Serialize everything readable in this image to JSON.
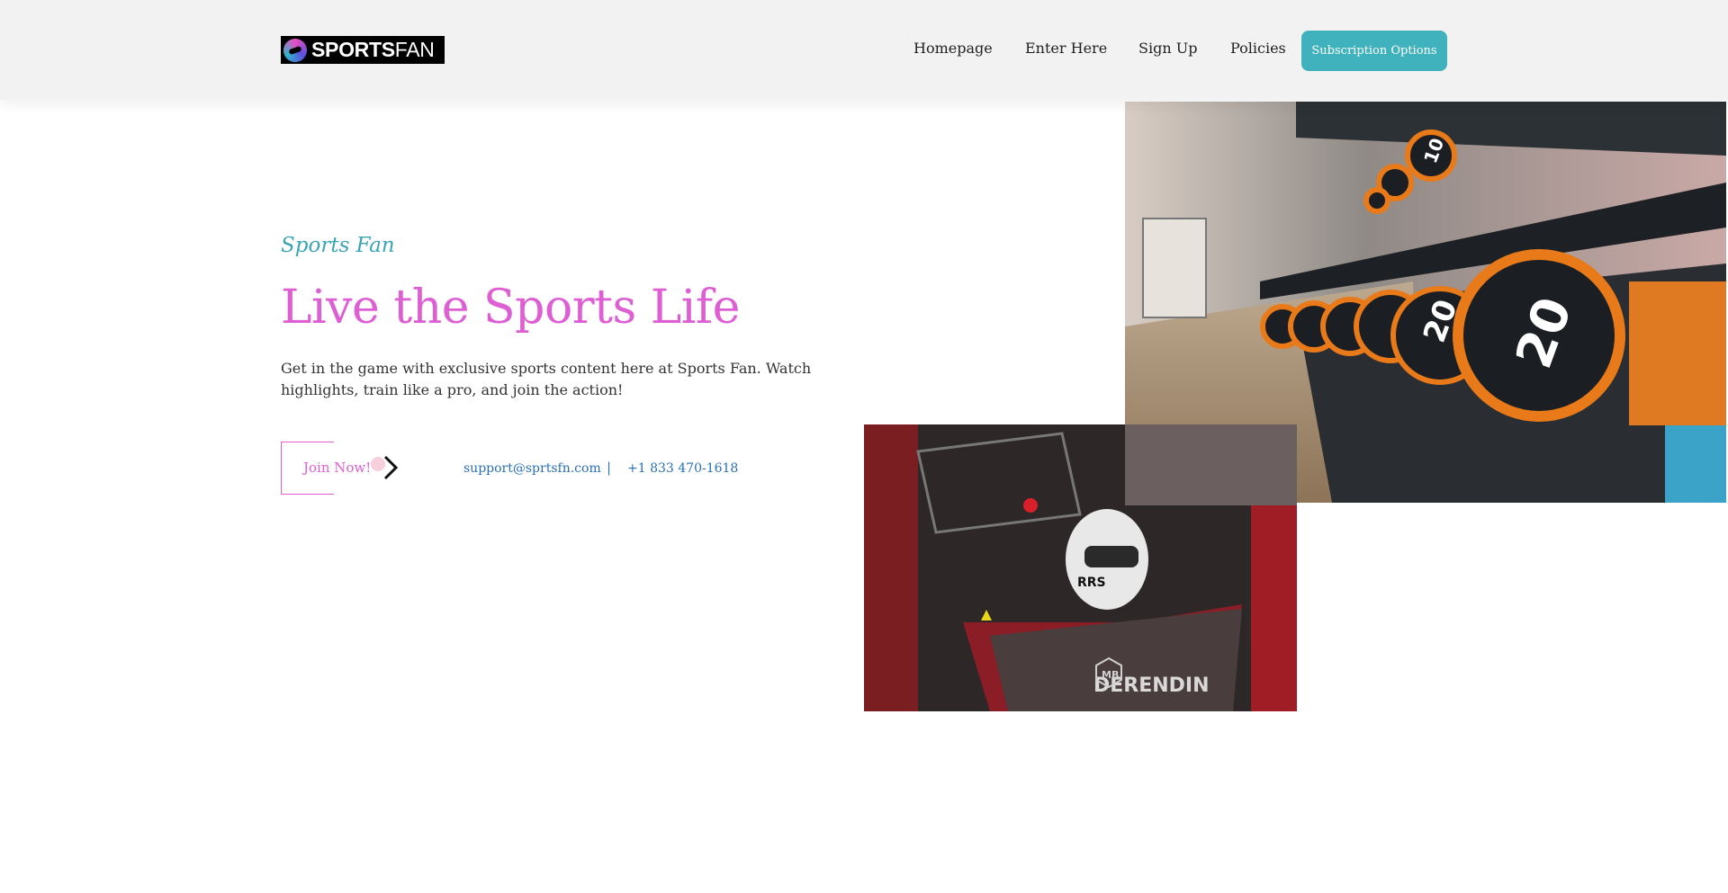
{
  "header": {
    "logo": {
      "bold_text": "SPORTS",
      "light_text": "FAN",
      "icon": "sportsfan-logo-icon"
    },
    "nav": [
      {
        "label": "Homepage"
      },
      {
        "label": "Enter Here"
      },
      {
        "label": "Sign Up"
      },
      {
        "label": "Policies"
      }
    ],
    "cta_label": "Subscription Options"
  },
  "hero": {
    "eyebrow": "Sports Fan",
    "headline": "Live the Sports Life",
    "intro": "Get in the game with exclusive sports content here at Sports Fan. Watch highlights, train like a pro, and join the action!",
    "join_label": "Join Now!",
    "email": "support@sprtsfn.com",
    "separator": "|",
    "phone": "+1 833 470-1618"
  },
  "images": {
    "gym_dumbbell_labels": [
      "20",
      "20",
      "10"
    ],
    "race_text": "DERENDIN",
    "race_helmet_text": "RRS",
    "race_badge": "MB"
  },
  "colors": {
    "accent_pink": "#dd5fd3",
    "accent_teal": "#3fb2bd",
    "link_blue": "#2a6fb5",
    "header_bg": "#f2f2f2"
  }
}
